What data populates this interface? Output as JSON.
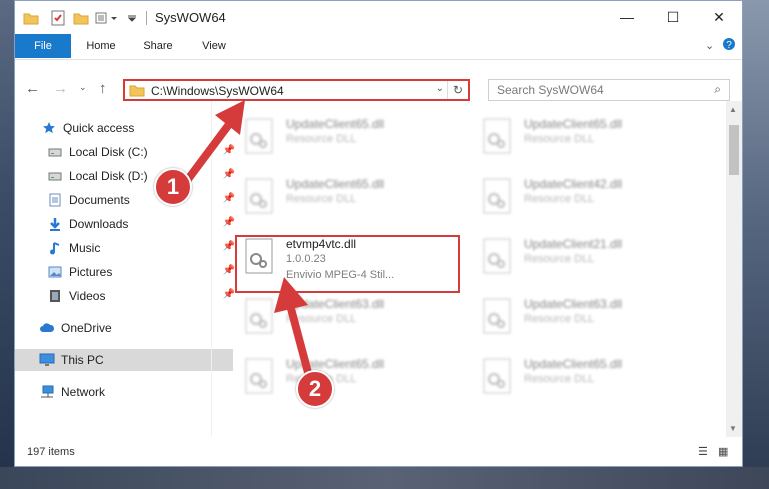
{
  "window": {
    "title": "SysWOW64",
    "controls": {
      "minimize": "—",
      "maximize": "☐",
      "close": "✕"
    }
  },
  "ribbon": {
    "tabs": [
      "File",
      "Home",
      "Share",
      "View"
    ],
    "expand_icon": "chevron-down-icon",
    "help_icon": "help-icon"
  },
  "address": {
    "path": "C:\\Windows\\SysWOW64",
    "search_placeholder": "Search SysWOW64"
  },
  "nav": {
    "items": [
      {
        "label": "Quick access",
        "icon": "star-icon",
        "pinned": false
      },
      {
        "label": "Local Disk (C:)",
        "icon": "drive-icon",
        "pinned": true
      },
      {
        "label": "Local Disk (D:)",
        "icon": "drive-icon",
        "pinned": true
      },
      {
        "label": "Documents",
        "icon": "documents-icon",
        "pinned": true
      },
      {
        "label": "Downloads",
        "icon": "downloads-icon",
        "pinned": true
      },
      {
        "label": "Music",
        "icon": "music-icon",
        "pinned": true
      },
      {
        "label": "Pictures",
        "icon": "pictures-icon",
        "pinned": true
      },
      {
        "label": "Videos",
        "icon": "videos-icon",
        "pinned": true
      },
      {
        "label": "OneDrive",
        "icon": "cloud-icon",
        "pinned": false
      },
      {
        "label": "This PC",
        "icon": "computer-icon",
        "pinned": false,
        "selected": true
      },
      {
        "label": "Network",
        "icon": "network-icon",
        "pinned": false
      }
    ]
  },
  "files": [
    {
      "name": "UpdateClient65.dll",
      "desc": "Resource DLL",
      "blurred": true
    },
    {
      "name": "UpdateClient65.dll",
      "desc": "Resource DLL",
      "blurred": true
    },
    {
      "name": "UpdateClient65.dll",
      "desc": "Resource DLL",
      "blurred": true
    },
    {
      "name": "UpdateClient42.dll",
      "desc": "Resource DLL",
      "blurred": true
    },
    {
      "name": "etvmp4vtc.dll",
      "version": "1.0.0.23",
      "desc": "Envivio MPEG-4 Stil...",
      "blurred": false
    },
    {
      "name": "UpdateClient21.dll",
      "desc": "Resource DLL",
      "blurred": true
    },
    {
      "name": "UpdateClient63.dll",
      "desc": "Resource DLL",
      "blurred": true
    },
    {
      "name": "UpdateClient63.dll",
      "desc": "Resource DLL",
      "blurred": true
    },
    {
      "name": "UpdateClient65.dll",
      "desc": "Resource DLL",
      "blurred": true
    },
    {
      "name": "UpdateClient65.dll",
      "desc": "Resource DLL",
      "blurred": true
    }
  ],
  "status": {
    "count": "197 items"
  },
  "annotations": {
    "step1": "1",
    "step2": "2",
    "color": "#d63b3b"
  }
}
